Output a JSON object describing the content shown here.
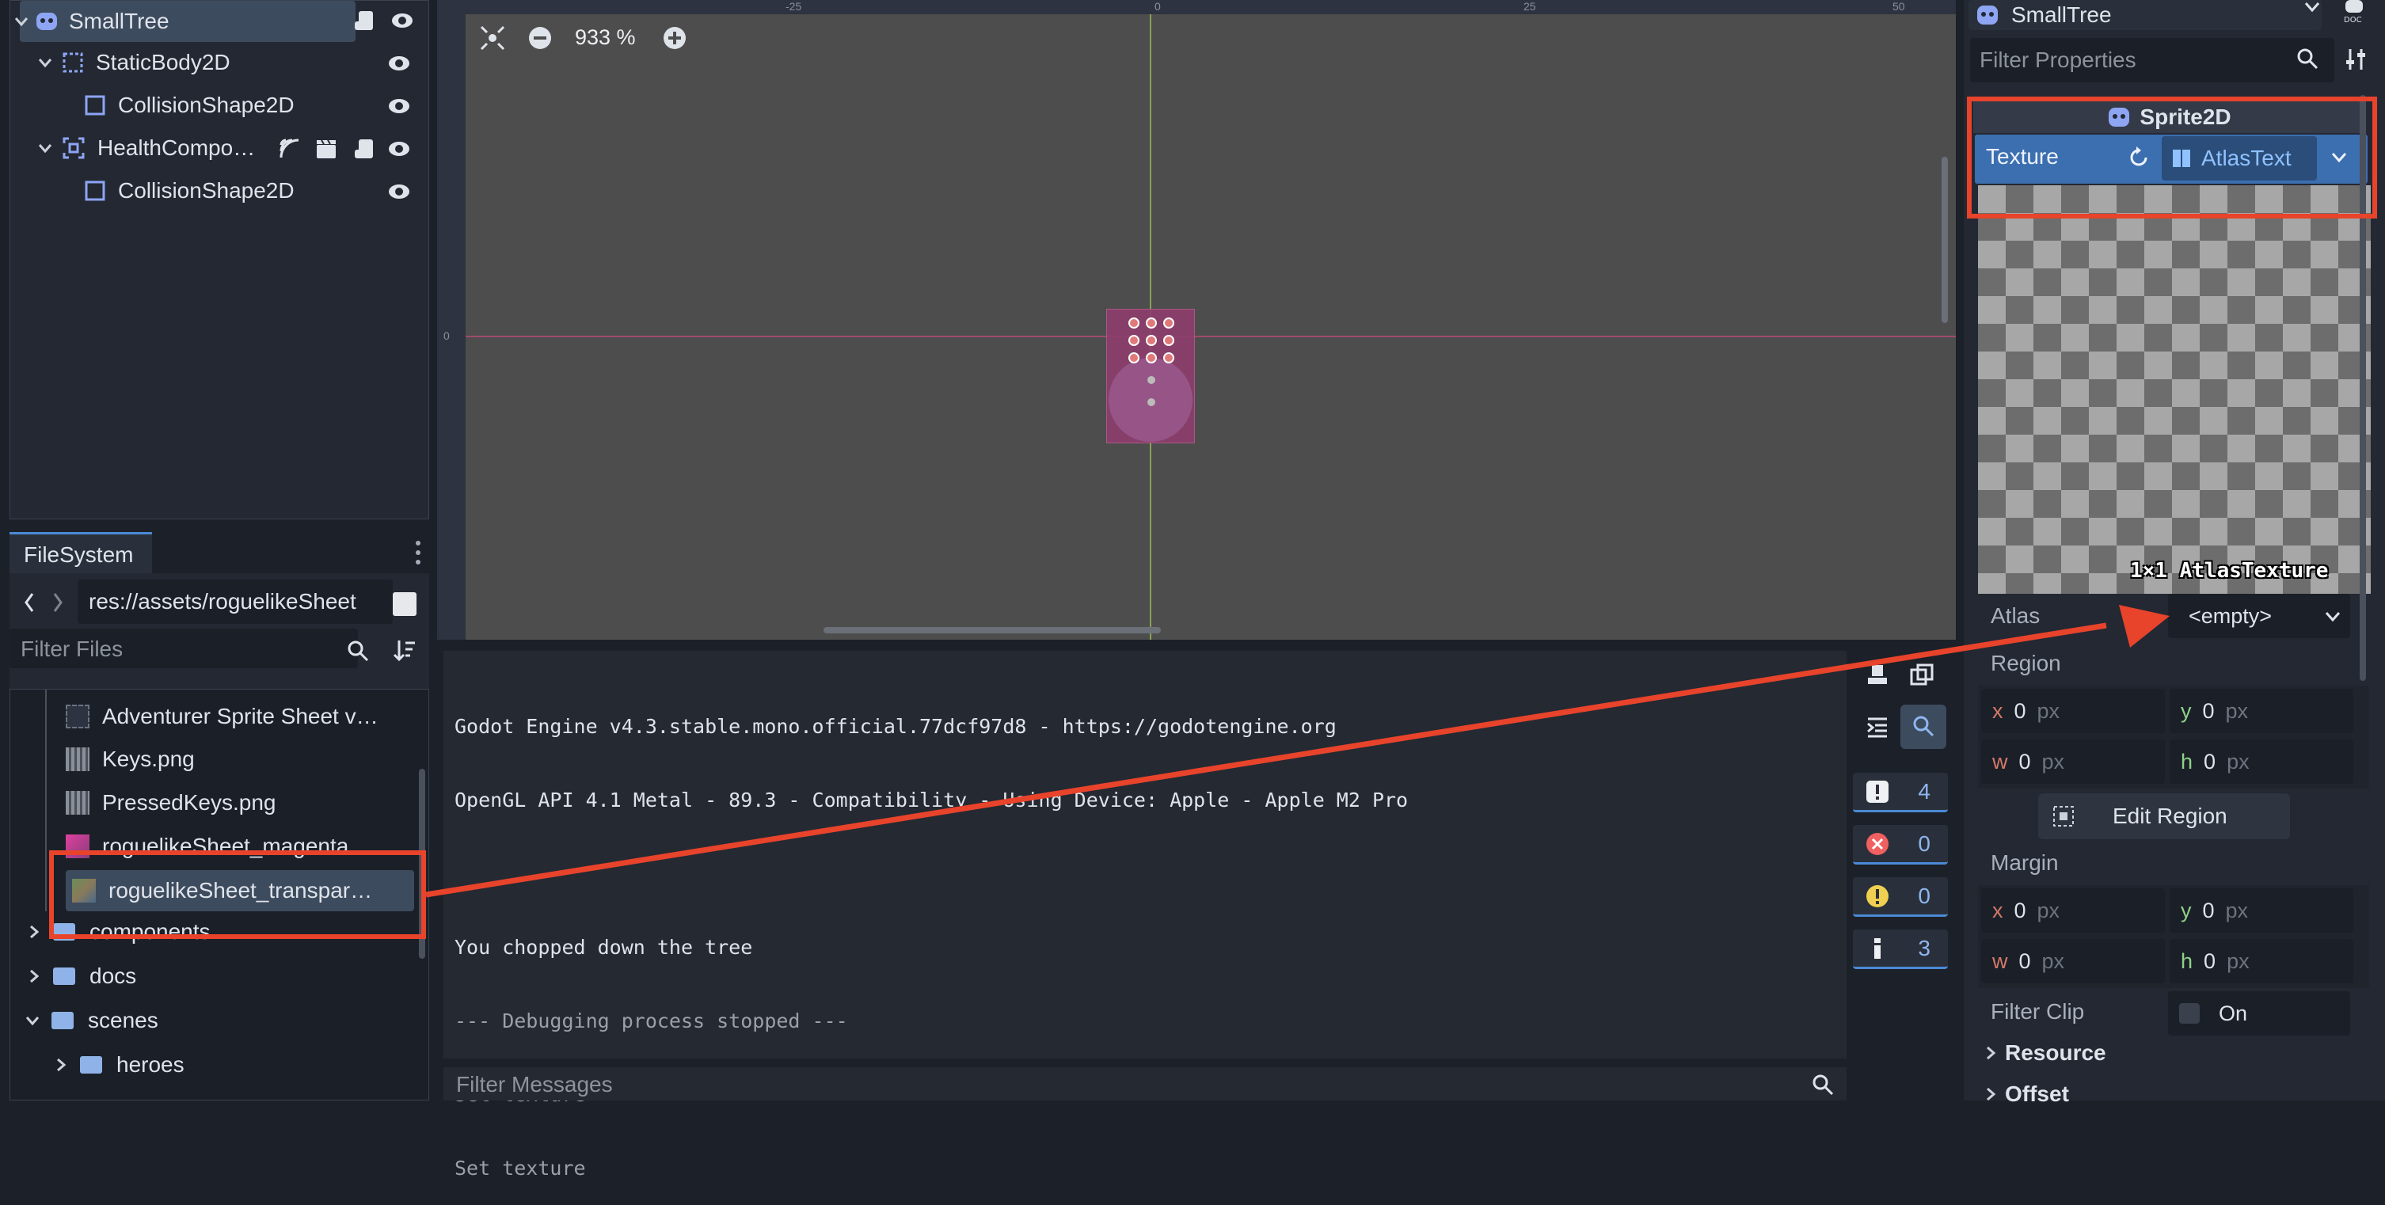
{
  "scene_tree": {
    "nodes": [
      {
        "label": "SmallTree",
        "depth": 0,
        "icon": "sprite-node-icon"
      },
      {
        "label": "StaticBody2D",
        "depth": 1,
        "icon": "staticbody-icon"
      },
      {
        "label": "CollisionShape2D",
        "depth": 2,
        "icon": "collision-shape-icon"
      },
      {
        "label": "HealthCompo…",
        "depth": 1,
        "icon": "health-component-icon"
      },
      {
        "label": "CollisionShape2D",
        "depth": 2,
        "icon": "collision-shape-icon"
      }
    ]
  },
  "filesystem": {
    "tab": "FileSystem",
    "path": "res://assets/roguelikeSheet",
    "filter_placeholder": "Filter Files",
    "items": [
      {
        "label": "Adventurer Sprite Sheet v…",
        "type": "file"
      },
      {
        "label": "Keys.png",
        "type": "file"
      },
      {
        "label": "PressedKeys.png",
        "type": "file"
      },
      {
        "label": "roguelikeSheet_magenta…",
        "type": "file"
      },
      {
        "label": "roguelikeSheet_transpar…",
        "type": "file",
        "selected": true
      },
      {
        "label": "components",
        "type": "folder"
      },
      {
        "label": "docs",
        "type": "folder"
      },
      {
        "label": "scenes",
        "type": "folder"
      },
      {
        "label": "heroes",
        "type": "folder"
      }
    ]
  },
  "viewport": {
    "zoom": "933 %",
    "ruler_labels": [
      "-25",
      "0",
      "25",
      "50",
      "0"
    ]
  },
  "output": {
    "lines": [
      "Godot Engine v4.3.stable.mono.official.77dcf97d8 - https://godotengine.org",
      "OpenGL API 4.1 Metal - 89.3 - Compatibility - Using Device: Apple - Apple M2 Pro",
      "",
      "You chopped down the tree",
      "--- Debugging process stopped ---",
      "Set texture",
      "Set texture"
    ],
    "filter_placeholder": "Filter Messages",
    "counts": {
      "all": "4",
      "errors": "0",
      "warnings": "0",
      "info": "3"
    }
  },
  "inspector": {
    "node": "SmallTree",
    "filter_placeholder": "Filter Properties",
    "class_name": "Sprite2D",
    "texture_label": "Texture",
    "texture_value": "AtlasText",
    "preview_caption": "1×1 AtlasTexture",
    "atlas_label": "Atlas",
    "atlas_value": "<empty>",
    "region_label": "Region",
    "region": {
      "x": "0",
      "y": "0",
      "w": "0",
      "h": "0"
    },
    "unit": "px",
    "edit_region": "Edit Region",
    "margin_label": "Margin",
    "margin": {
      "x": "0",
      "y": "0",
      "w": "0",
      "h": "0"
    },
    "filter_clip_label": "Filter Clip",
    "filter_clip_value": "On",
    "resource_label": "Resource",
    "offset_label": "Offset"
  },
  "colors": {
    "accent": "#4b8ad6",
    "annotation": "#e8432b",
    "selection": "#3d4b5e"
  }
}
